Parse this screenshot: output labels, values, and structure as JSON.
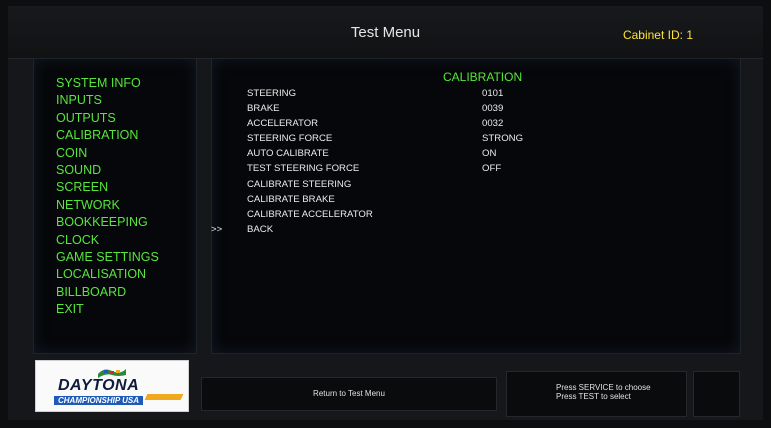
{
  "header": {
    "title": "Test Menu",
    "cabinet_id": "Cabinet ID: 1"
  },
  "sidebar": {
    "items": [
      {
        "label": "SYSTEM INFO"
      },
      {
        "label": "INPUTS"
      },
      {
        "label": "OUTPUTS"
      },
      {
        "label": "CALIBRATION"
      },
      {
        "label": "COIN"
      },
      {
        "label": "SOUND"
      },
      {
        "label": "SCREEN"
      },
      {
        "label": "NETWORK"
      },
      {
        "label": "BOOKKEEPING"
      },
      {
        "label": "CLOCK"
      },
      {
        "label": "GAME SETTINGS"
      },
      {
        "label": "LOCALISATION"
      },
      {
        "label": "BILLBOARD"
      },
      {
        "label": "EXIT"
      }
    ]
  },
  "main": {
    "section_title": "CALIBRATION",
    "rows": [
      {
        "label": "STEERING",
        "value": "0101"
      },
      {
        "label": "BRAKE",
        "value": "0039"
      },
      {
        "label": "ACCELERATOR",
        "value": "0032"
      },
      {
        "label": "STEERING FORCE",
        "value": "STRONG"
      },
      {
        "label": "AUTO CALIBRATE",
        "value": "ON"
      },
      {
        "label": "TEST STEERING FORCE",
        "value": "OFF"
      },
      {
        "label": "CALIBRATE STEERING",
        "value": ""
      },
      {
        "label": "CALIBRATE BRAKE",
        "value": ""
      },
      {
        "label": "CALIBRATE ACCELERATOR",
        "value": ""
      },
      {
        "label": "BACK",
        "value": "",
        "cursor": ">>"
      }
    ]
  },
  "logo": {
    "main": "DAYTONA",
    "sub": "CHAMPIONSHIP USA"
  },
  "footer": {
    "return_text": "Return to Test Menu",
    "instructions_1": "Press SERVICE to choose",
    "instructions_2": "Press TEST to select"
  }
}
